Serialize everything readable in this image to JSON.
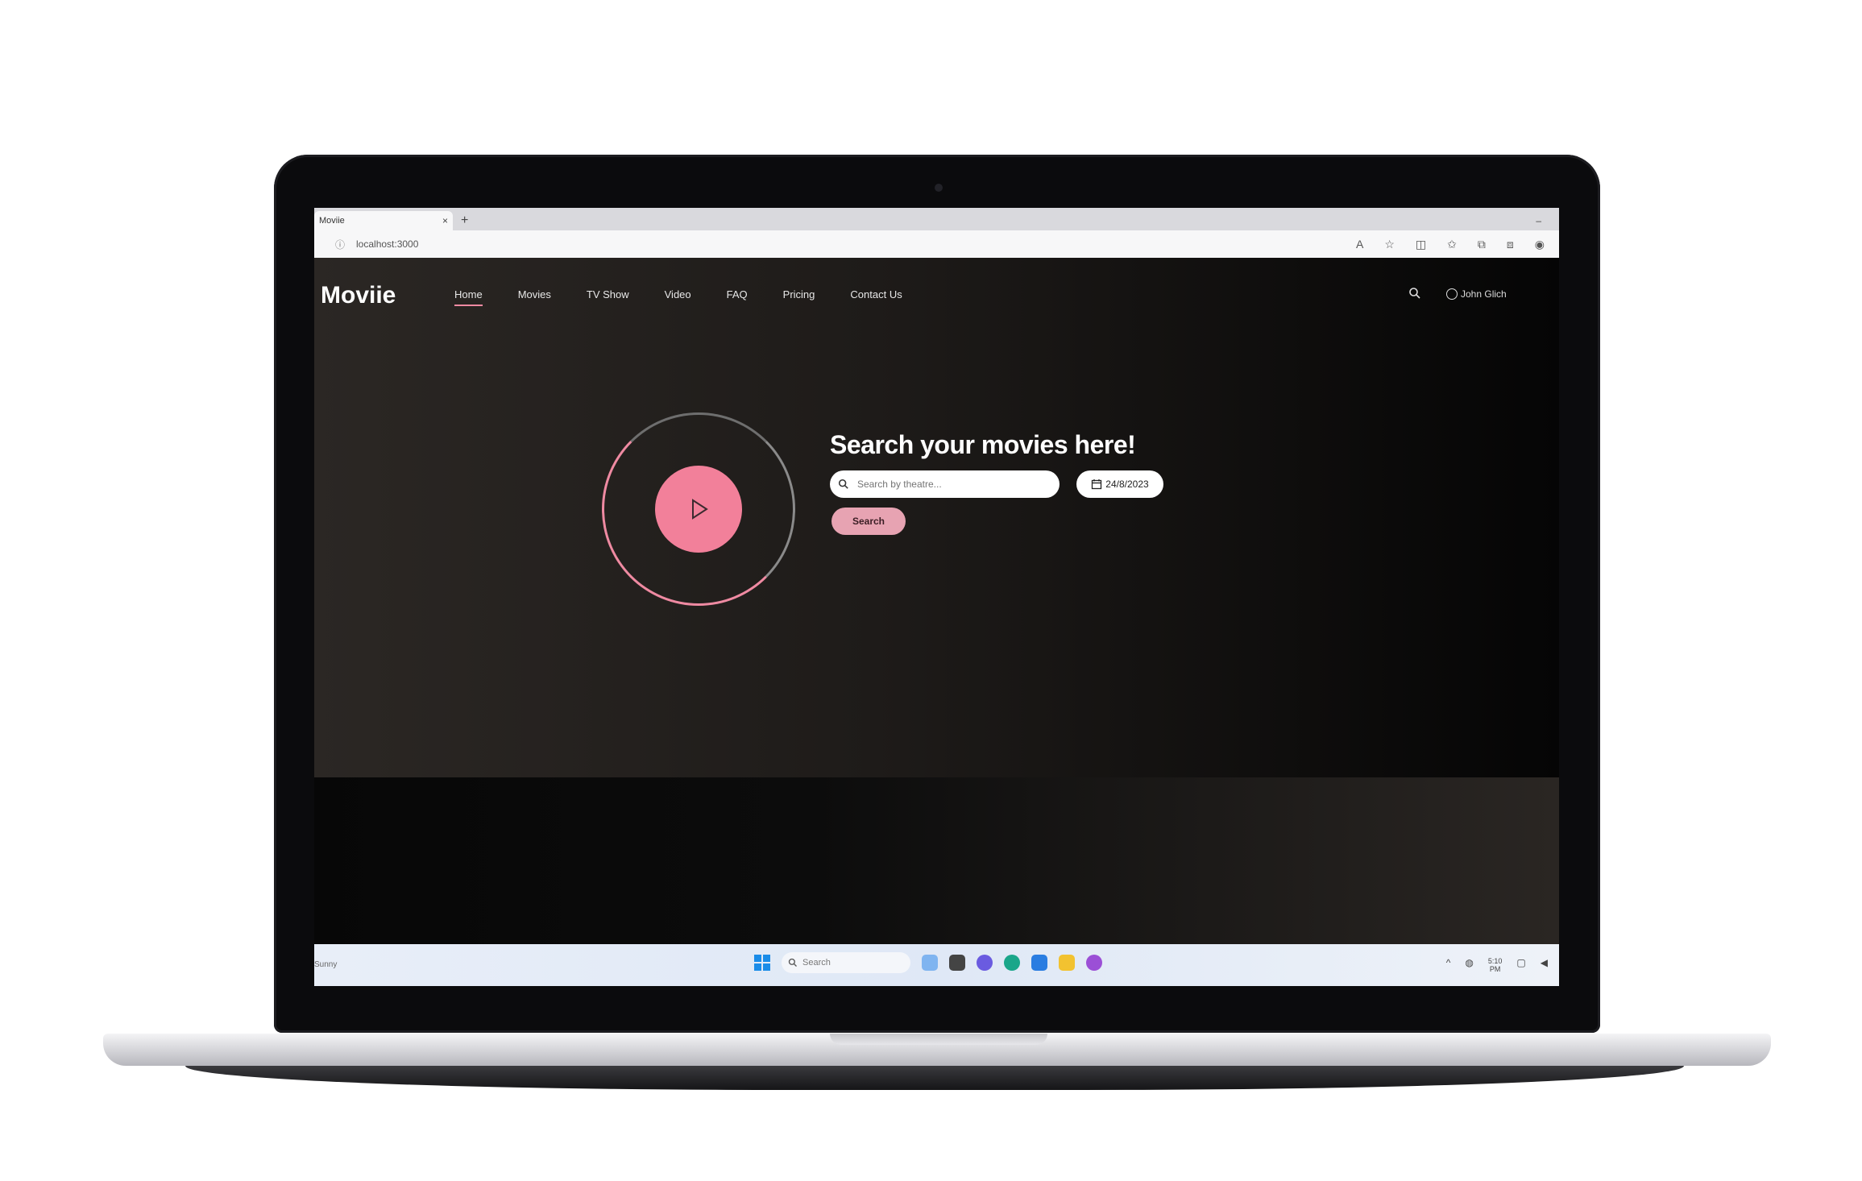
{
  "browser": {
    "tab_title": "Moviie",
    "tab_close": "×",
    "new_tab": "+",
    "minimize": "–",
    "url": "localhost:3000"
  },
  "site": {
    "logo": "Moviie",
    "nav": [
      "Home",
      "Movies",
      "TV Show",
      "Video",
      "FAQ",
      "Pricing",
      "Contact Us"
    ],
    "user_name": "John Glich"
  },
  "hero": {
    "title": "Search your movies here!",
    "search_placeholder": "Search by theatre...",
    "date_value": "24/8/2023",
    "search_button": "Search"
  },
  "taskbar": {
    "search_placeholder": "Search",
    "left_label": "Sunny",
    "time": "5:10",
    "date": "PM"
  },
  "colors": {
    "accent_pink": "#f2809a",
    "button_pink": "#e7a3b2"
  }
}
